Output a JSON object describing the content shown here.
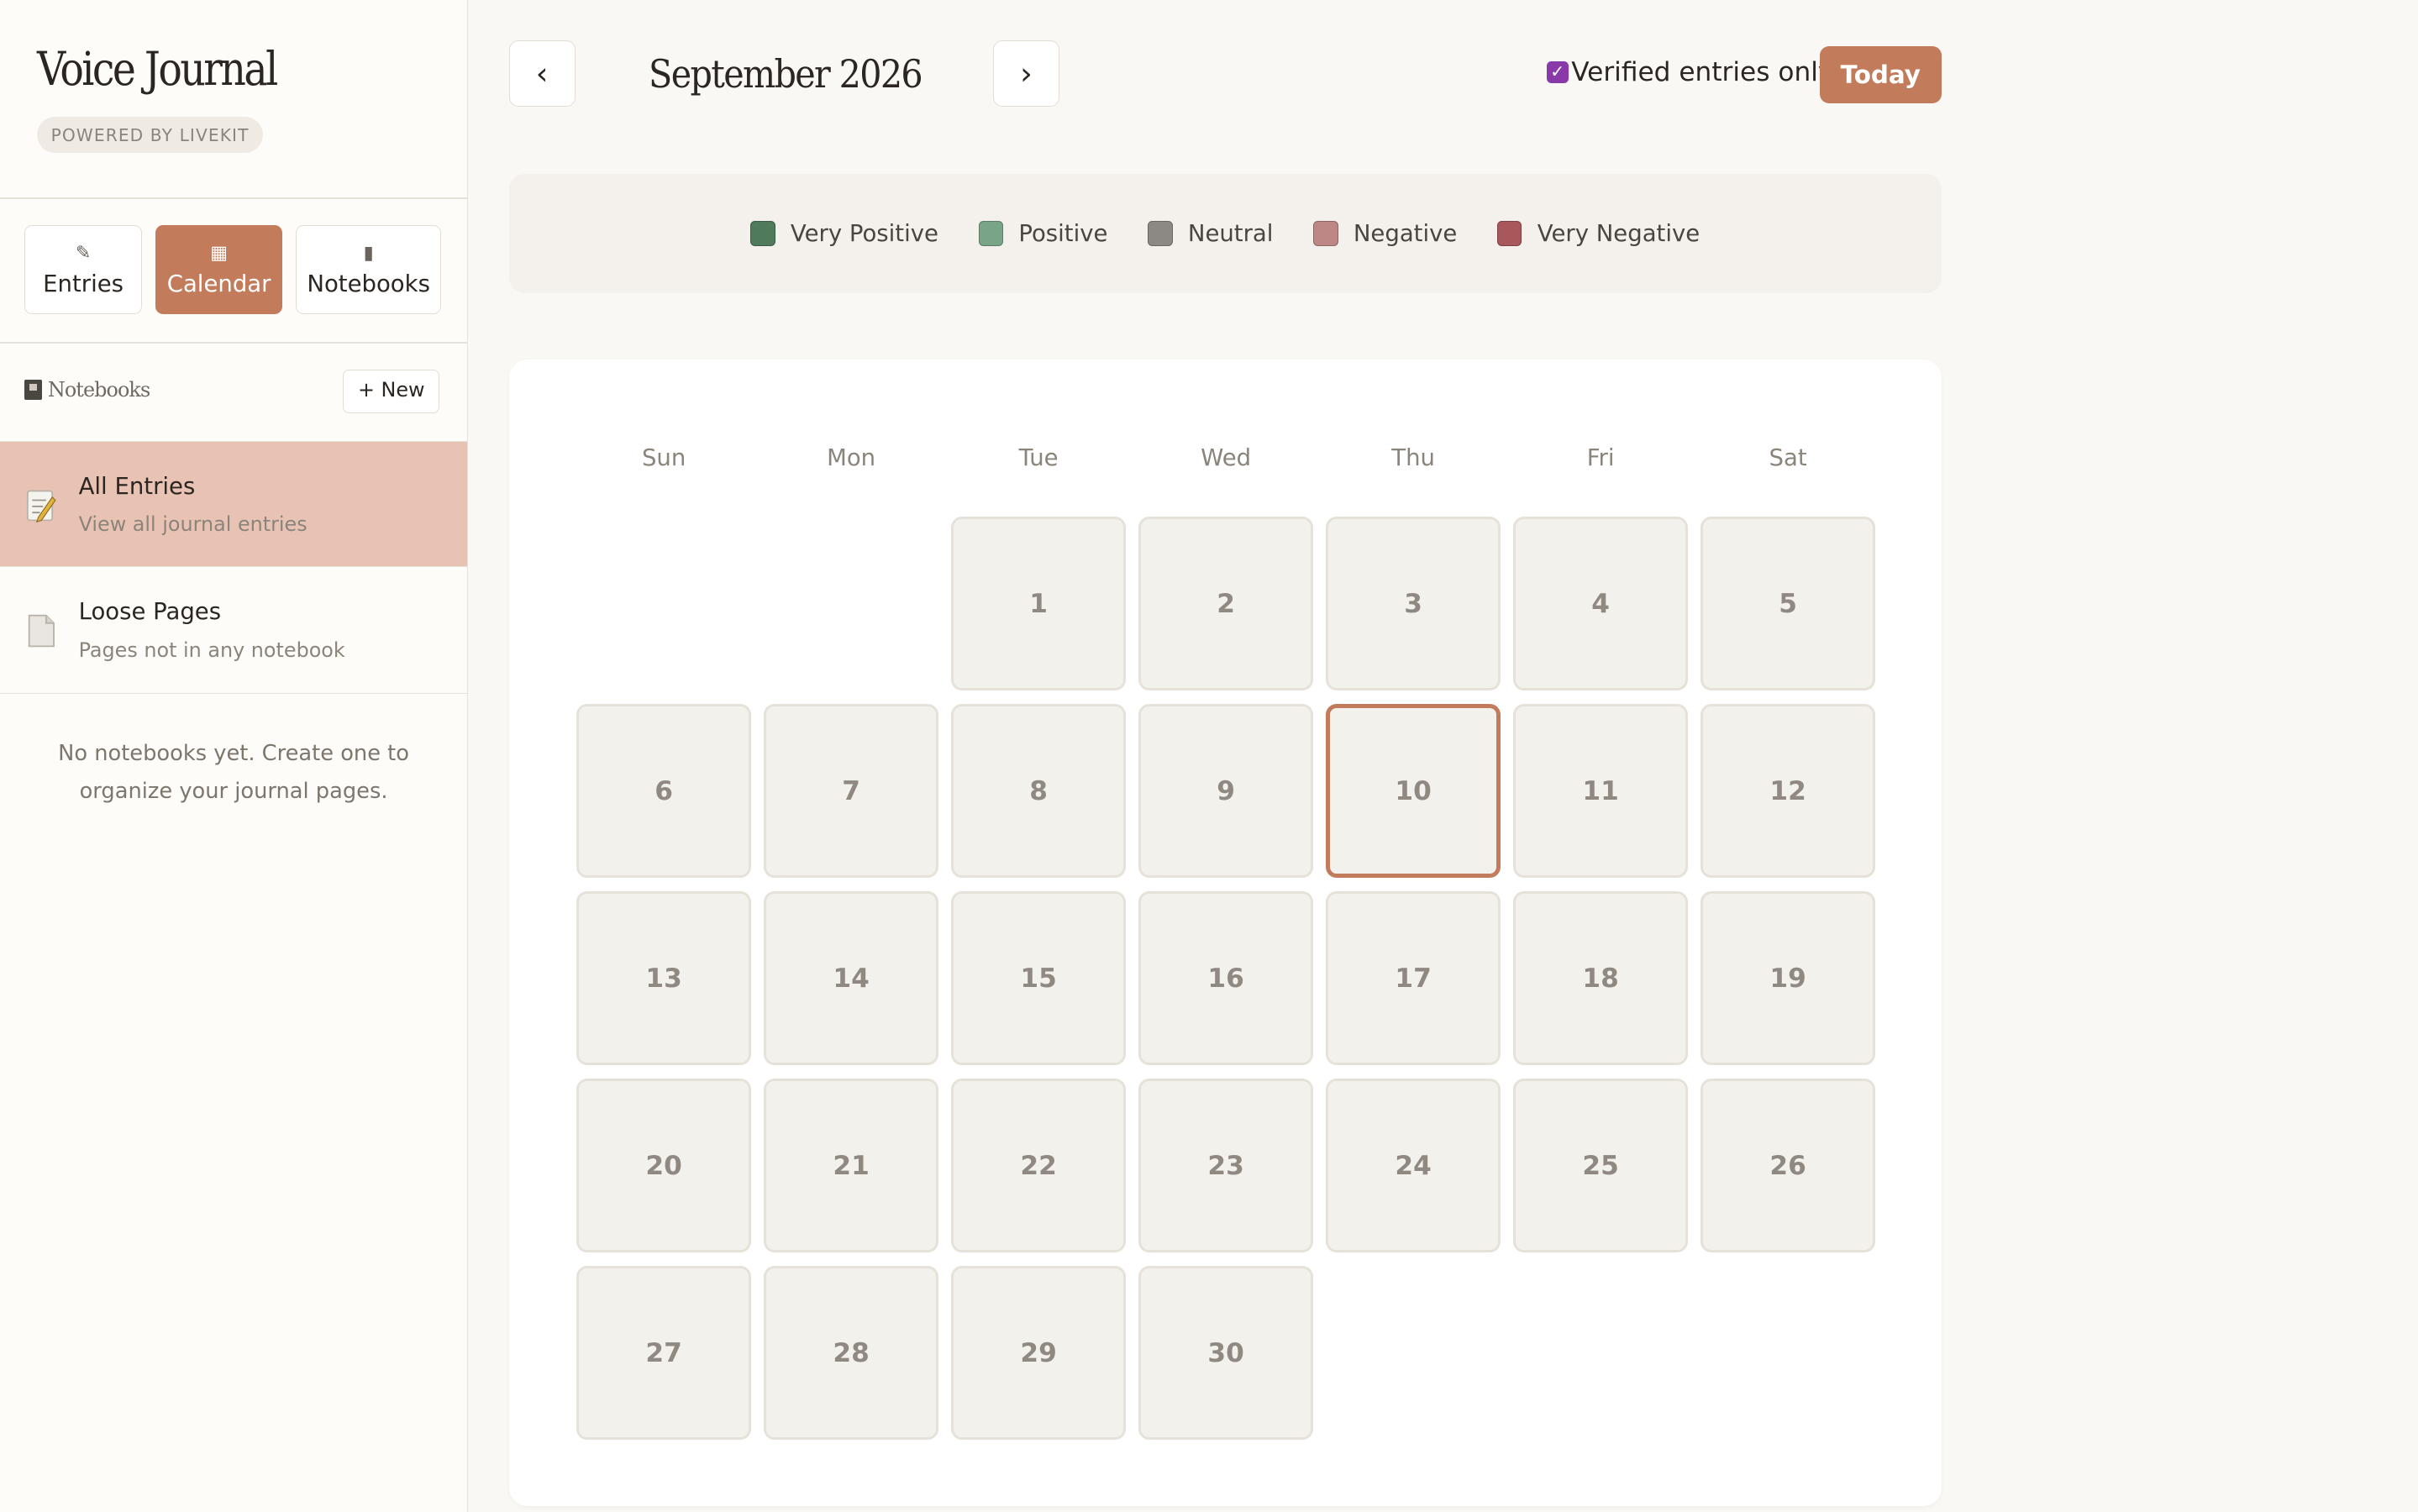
{
  "sidebar": {
    "app_title": "Voice Journal",
    "powered_by": "POWERED BY LIVEKIT",
    "tabs": [
      {
        "label": "Entries",
        "icon": "memo-icon"
      },
      {
        "label": "Calendar",
        "icon": "calendar-icon",
        "active": true
      },
      {
        "label": "Notebooks",
        "icon": "notebook-icon"
      }
    ],
    "notebooks_header": "Notebooks",
    "new_button": "+ New",
    "items": [
      {
        "title": "All Entries",
        "subtitle": "View all journal entries",
        "selected": true
      },
      {
        "title": "Loose Pages",
        "subtitle": "Pages not in any notebook"
      }
    ],
    "empty_message": "No notebooks yet. Create one to organize your journal pages."
  },
  "header": {
    "prev": "‹",
    "next": "›",
    "month": "September 2026",
    "verified_label": "Verified entries only",
    "verified_checked": true,
    "today_button": "Today"
  },
  "legend": [
    {
      "label": "Very Positive",
      "color": "#4f7a5c"
    },
    {
      "label": "Positive",
      "color": "#79a487"
    },
    {
      "label": "Neutral",
      "color": "#8c8883"
    },
    {
      "label": "Negative",
      "color": "#bd8785"
    },
    {
      "label": "Very Negative",
      "color": "#a8575a"
    }
  ],
  "calendar": {
    "weekdays": [
      "Sun",
      "Mon",
      "Tue",
      "Wed",
      "Thu",
      "Fri",
      "Sat"
    ],
    "first_weekday": 2,
    "days_in_month": 30,
    "today": 10
  },
  "colors": {
    "accent": "#c27c5c",
    "selected_row": "#e8c3b4",
    "checkbox": "#8a3aa8"
  }
}
